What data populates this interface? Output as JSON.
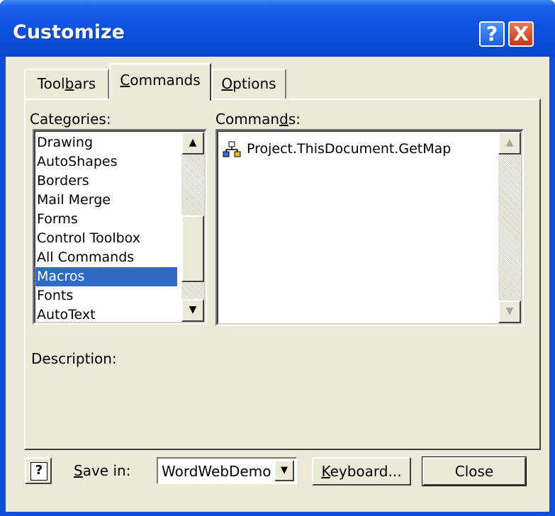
{
  "window": {
    "title": "Customize",
    "help_glyph": "?",
    "close_glyph": "X"
  },
  "tabs": [
    {
      "pre": "Tool",
      "ul": "b",
      "post": "ars"
    },
    {
      "pre": "",
      "ul": "C",
      "post": "ommands"
    },
    {
      "pre": "",
      "ul": "O",
      "post": "ptions"
    }
  ],
  "categories": {
    "label_pre": "Cate",
    "label_ul": "g",
    "label_post": "ories:",
    "items": [
      "Drawing",
      "AutoShapes",
      "Borders",
      "Mail Merge",
      "Forms",
      "Control Toolbox",
      "All Commands",
      "Macros",
      "Fonts",
      "AutoText"
    ],
    "selected": "Macros"
  },
  "commands": {
    "label_pre": "Comman",
    "label_ul": "d",
    "label_post": "s:",
    "items": [
      "Project.ThisDocument.GetMap"
    ],
    "icon": "macro-icon"
  },
  "description": {
    "label": "Description:"
  },
  "bottom": {
    "save_in_ul": "S",
    "save_in_post": "ave in:",
    "save_in_value": "WordWebDemo",
    "keyboard_ul": "K",
    "keyboard_post": "eyboard...",
    "close": "Close"
  },
  "colors": {
    "titlebar": "#0a4fd6",
    "dialog_bg": "#ece9d8",
    "selection": "#316ac5",
    "close_button": "#c2391a"
  }
}
